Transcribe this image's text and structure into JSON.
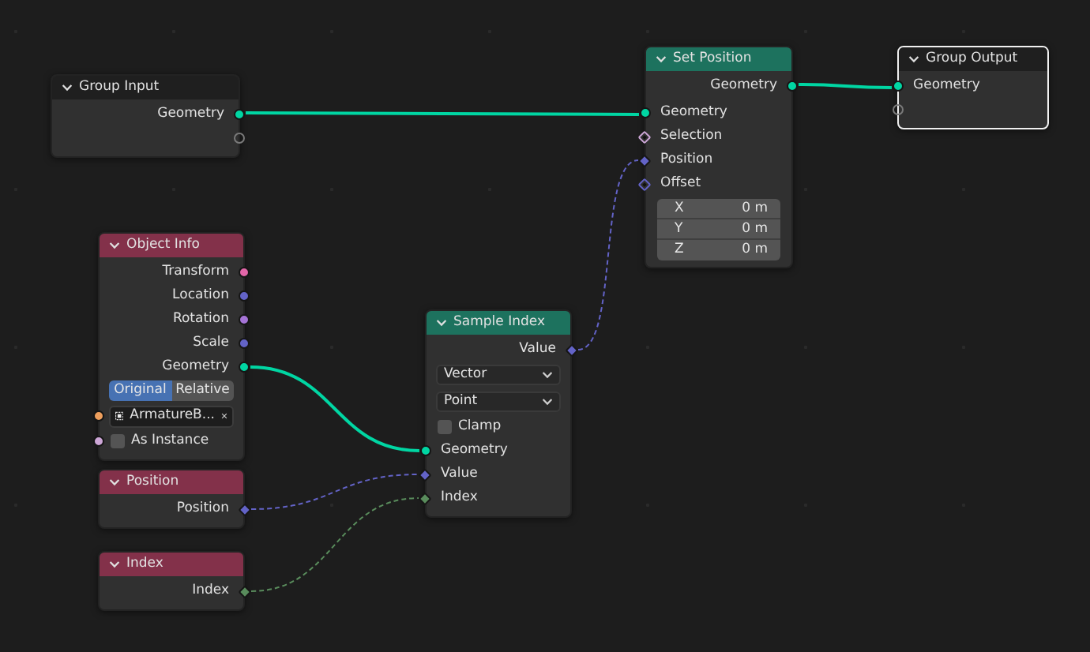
{
  "nodes": [
    {
      "title": "Group Input",
      "color": "#1f1f1f",
      "selected": false,
      "rows": [
        {
          "kind": "output",
          "label": "Geometry",
          "socket": {
            "kind": "circle",
            "color": "#00d6a3"
          }
        },
        {
          "kind": "output",
          "socket": {
            "kind": "hollow",
            "color": "#7a7a7a"
          }
        }
      ]
    },
    {
      "title": "Set Position",
      "color": "#1d725e",
      "selected": false,
      "rows": [
        {
          "kind": "output",
          "label": "Geometry",
          "socket": {
            "kind": "circle",
            "color": "#00d6a3"
          }
        },
        {
          "kind": "input",
          "label": "Geometry",
          "socket": {
            "kind": "circle",
            "color": "#00d6a3"
          }
        },
        {
          "kind": "input",
          "label": "Selection",
          "socket": {
            "kind": "dotted",
            "color": "#cca6d6"
          }
        },
        {
          "kind": "input",
          "label": "Position",
          "socket": {
            "kind": "diamond",
            "color": "#6363c7"
          }
        },
        {
          "kind": "input",
          "label": "Offset",
          "socket": {
            "kind": "dotted",
            "color": "#6363c7"
          }
        },
        {
          "kind": "vector",
          "fields": [
            {
              "label": "X",
              "value": "0 m"
            },
            {
              "label": "Y",
              "value": "0 m"
            },
            {
              "label": "Z",
              "value": "0 m"
            }
          ]
        }
      ]
    },
    {
      "title": "Group Output",
      "color": "#1f1f1f",
      "selected": true,
      "rows": [
        {
          "kind": "input",
          "label": "Geometry",
          "socket": {
            "kind": "circle",
            "color": "#00d6a3"
          }
        },
        {
          "kind": "input",
          "socket": {
            "kind": "hollow",
            "color": "#7a7a7a"
          }
        }
      ]
    },
    {
      "title": "Object Info",
      "color": "#83314a",
      "selected": false,
      "rows": [
        {
          "kind": "output",
          "label": "Transform",
          "socket": {
            "kind": "circle",
            "color": "#e266a8"
          }
        },
        {
          "kind": "output",
          "label": "Location",
          "socket": {
            "kind": "circle",
            "color": "#6363c7"
          }
        },
        {
          "kind": "output",
          "label": "Rotation",
          "socket": {
            "kind": "circle",
            "color": "#a574d6"
          }
        },
        {
          "kind": "output",
          "label": "Scale",
          "socket": {
            "kind": "circle",
            "color": "#6363c7"
          }
        },
        {
          "kind": "output",
          "label": "Geometry",
          "socket": {
            "kind": "circle",
            "color": "#00d6a3"
          }
        },
        {
          "kind": "toggle",
          "options": [
            {
              "label": "Original",
              "selected": true
            },
            {
              "label": "Relative",
              "selected": false
            }
          ]
        },
        {
          "kind": "object",
          "value": "ArmatureB...",
          "socket": {
            "kind": "circle",
            "color": "#ed9e5c"
          }
        },
        {
          "kind": "checkbox",
          "label": "As Instance",
          "checked": false,
          "socket": {
            "kind": "circle",
            "color": "#cca6d6"
          }
        }
      ]
    },
    {
      "title": "Sample Index",
      "color": "#1d725e",
      "selected": false,
      "rows": [
        {
          "kind": "output",
          "label": "Value",
          "socket": {
            "kind": "diamond",
            "color": "#6363c7"
          }
        },
        {
          "kind": "dropdown",
          "value": "Vector"
        },
        {
          "kind": "dropdown",
          "value": "Point"
        },
        {
          "kind": "checkbox",
          "label": "Clamp",
          "checked": false
        },
        {
          "kind": "input",
          "label": "Geometry",
          "socket": {
            "kind": "circle",
            "color": "#00d6a3"
          }
        },
        {
          "kind": "input",
          "label": "Value",
          "socket": {
            "kind": "diamond",
            "color": "#6363c7"
          }
        },
        {
          "kind": "input",
          "label": "Index",
          "socket": {
            "kind": "diamond",
            "color": "#598c5c"
          }
        }
      ]
    },
    {
      "title": "Position",
      "color": "#83314a",
      "selected": false,
      "rows": [
        {
          "kind": "output",
          "label": "Position",
          "socket": {
            "kind": "diamond",
            "color": "#6363c7"
          }
        }
      ]
    },
    {
      "title": "Index",
      "color": "#83314a",
      "selected": false,
      "rows": [
        {
          "kind": "output",
          "label": "Index",
          "socket": {
            "kind": "diamond",
            "color": "#598c5c"
          }
        }
      ]
    }
  ],
  "links": [
    {
      "field": false
    },
    {
      "field": false
    },
    {
      "field": false
    },
    {
      "field": true
    },
    {
      "field": true
    },
    {
      "field": true
    }
  ]
}
